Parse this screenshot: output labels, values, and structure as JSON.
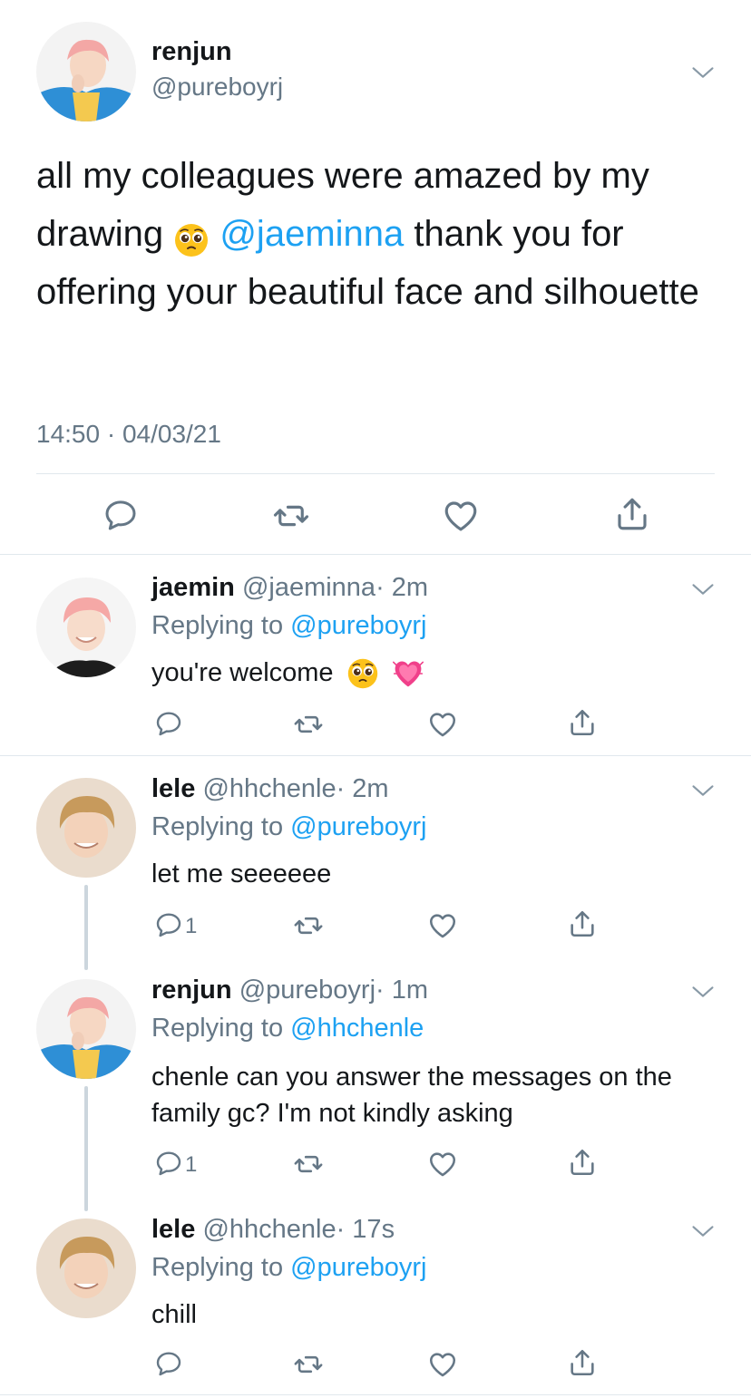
{
  "main_tweet": {
    "name": "renjun",
    "handle": "@pureboyrj",
    "text_part1": "all my colleagues were amazed by my drawing ",
    "emoji": "pleading-face",
    "mention": "@jaeminna",
    "text_part2": " thank you for offering your beautiful face and silhouette",
    "timestamp": "14:50 · 04/03/21"
  },
  "replies": [
    {
      "name": "jaemin",
      "handle": "@jaeminna",
      "time": "· 2m",
      "replying_label": "Replying to ",
      "replying_to": "@pureboyrj",
      "text": "you're welcome",
      "emojis": [
        "pleading-face",
        "growing-heart"
      ],
      "reply_count": ""
    },
    {
      "name": "lele",
      "handle": "@hhchenle",
      "time": "· 2m",
      "replying_label": "Replying to ",
      "replying_to": "@pureboyrj",
      "text": "let me seeeeee",
      "reply_count": "1"
    },
    {
      "name": "renjun",
      "handle": "@pureboyrj",
      "time": "· 1m",
      "replying_label": "Replying to ",
      "replying_to": "@hhchenle",
      "text": "chenle can you answer the messages on the family gc? I'm not kindly asking",
      "reply_count": "1"
    },
    {
      "name": "lele",
      "handle": "@hhchenle",
      "time": "· 17s",
      "replying_label": "Replying to ",
      "replying_to": "@pureboyrj",
      "text": "chill",
      "reply_count": ""
    }
  ],
  "colors": {
    "accent": "#1da1f2",
    "secondary_text": "#657786",
    "divider": "#e1e8ed",
    "thread_line": "#ccd6dd"
  },
  "icons": [
    "chevron-down-icon",
    "reply-icon",
    "retweet-icon",
    "like-icon",
    "share-icon"
  ]
}
